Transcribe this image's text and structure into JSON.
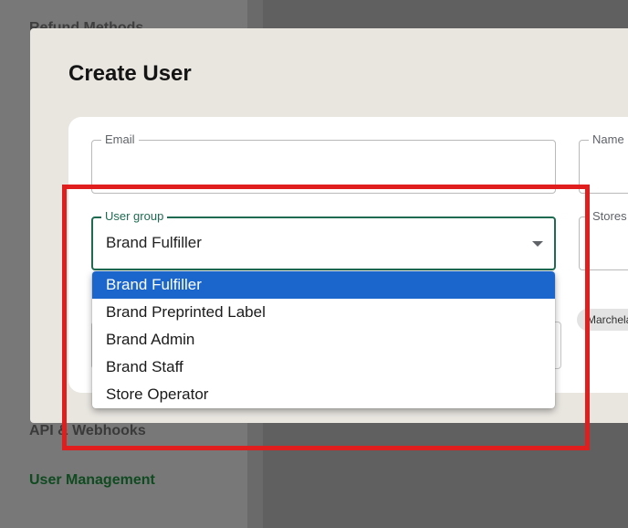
{
  "sidebar": {
    "items": [
      {
        "label": "Refund Methods"
      },
      {
        "label": "API & Webhooks"
      },
      {
        "label": "User Management"
      }
    ]
  },
  "modal": {
    "title": "Create User",
    "fields": {
      "email": {
        "label": "Email",
        "value": ""
      },
      "name": {
        "label": "Name",
        "value": ""
      },
      "user_group": {
        "label": "User group",
        "value": "Brand Fulfiller"
      },
      "stores": {
        "label": "Stores",
        "value": ""
      }
    },
    "store_chip": "Marchela"
  },
  "dropdown": {
    "options": [
      {
        "label": "Brand Fulfiller",
        "selected": true
      },
      {
        "label": "Brand Preprinted Label",
        "selected": false
      },
      {
        "label": "Brand Admin",
        "selected": false
      },
      {
        "label": "Brand Staff",
        "selected": false
      },
      {
        "label": "Store Operator",
        "selected": false
      }
    ]
  },
  "colors": {
    "accent_green": "#1e6b52",
    "selected_blue": "#1a66cc",
    "highlight_red": "#e01e1e"
  }
}
